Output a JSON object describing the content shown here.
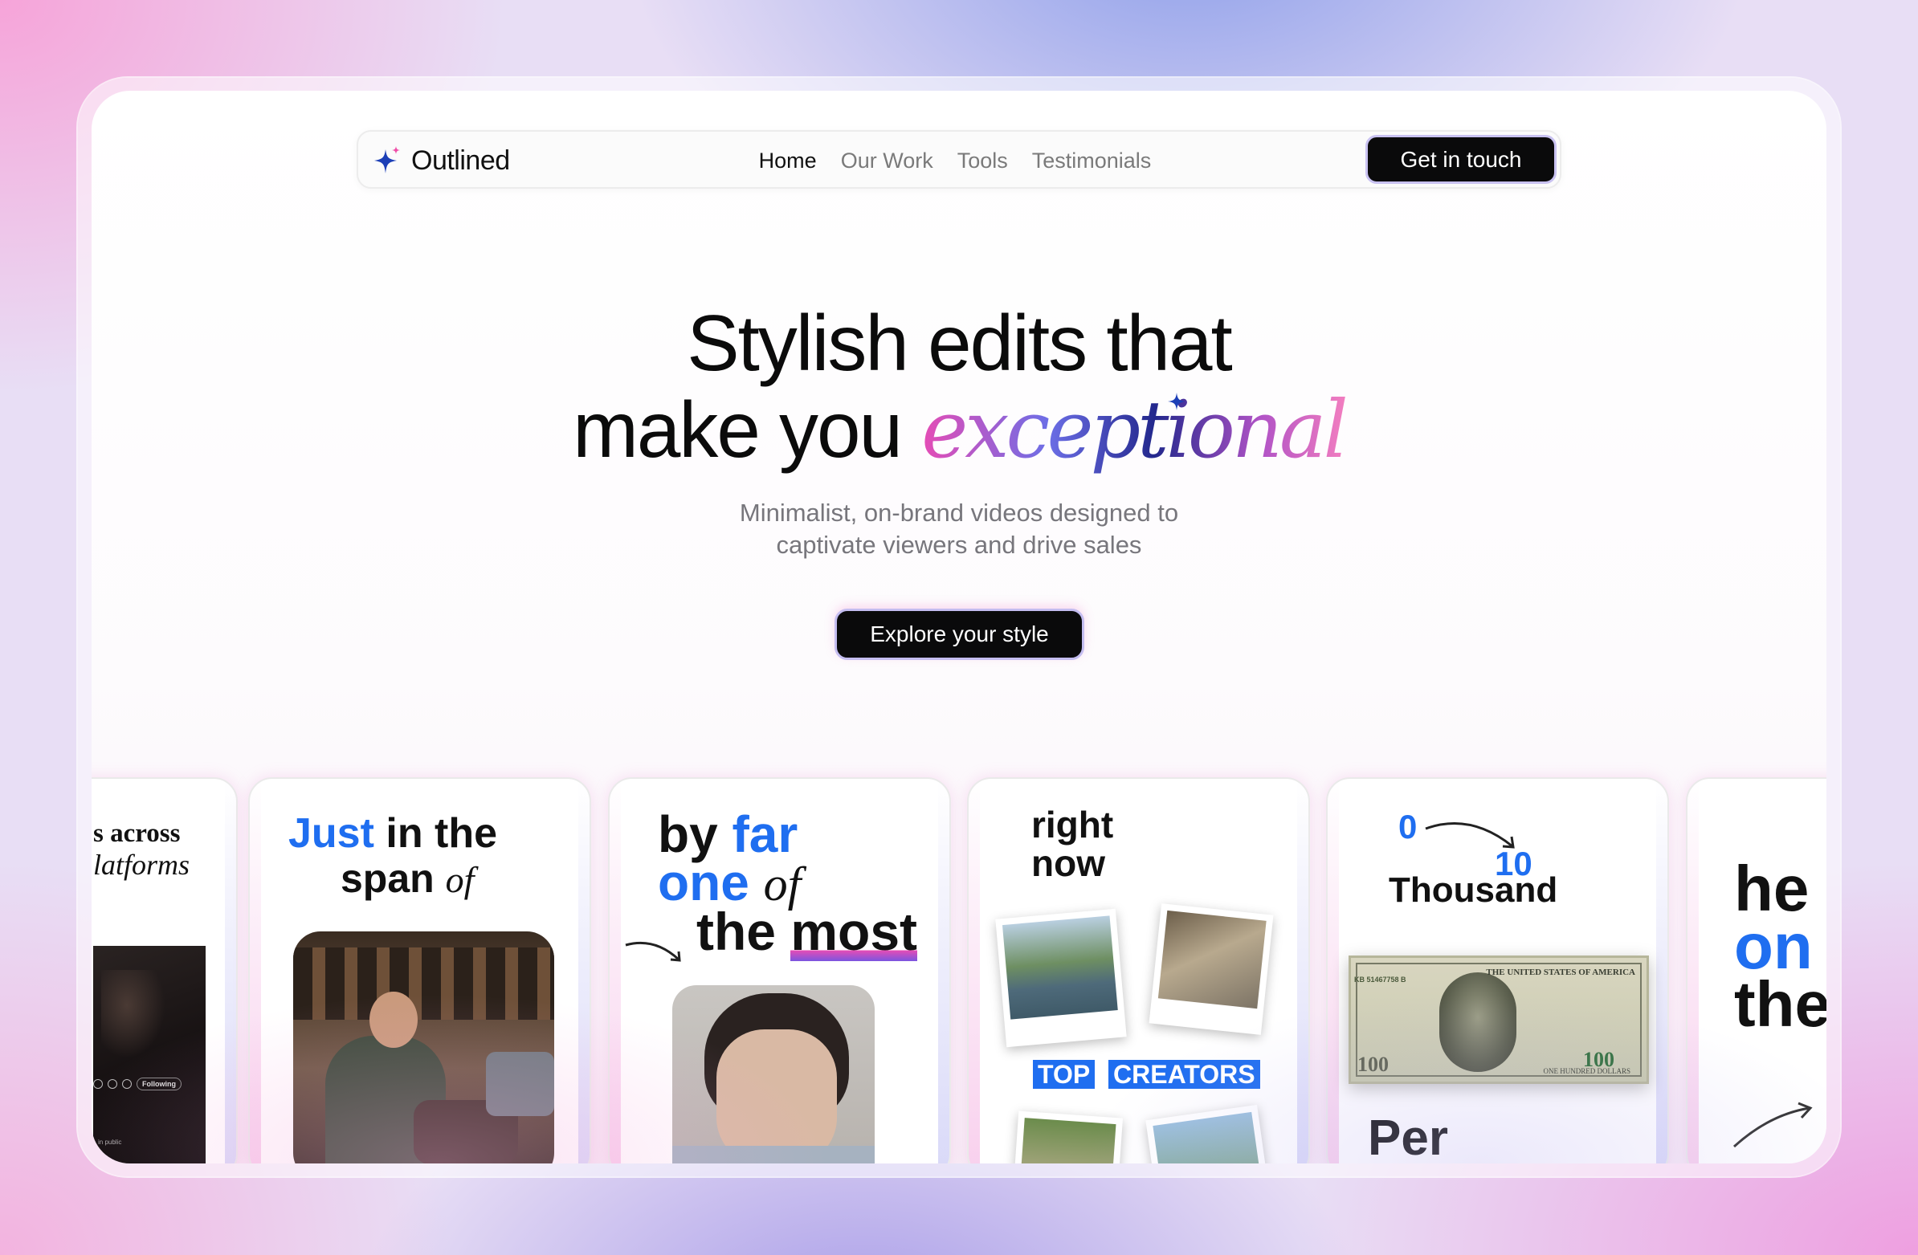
{
  "brand": {
    "name": "Outlined",
    "logo_icon": "sparkle-star-icon"
  },
  "nav": {
    "links": [
      "Home",
      "Our Work",
      "Tools",
      "Testimonials"
    ],
    "active": "Home",
    "cta": "Get in touch"
  },
  "hero": {
    "title_line1": "Stylish edits that",
    "title_line2_plain": "make you ",
    "title_line2_accent": "exceptional",
    "subtitle_line1": "Minimalist, on-brand videos designed to",
    "subtitle_line2": "captivate viewers and drive sales",
    "cta": "Explore your style"
  },
  "cards": {
    "c0": {
      "line1": "s across",
      "line2": "latforms",
      "chip": "Following",
      "footer": "in public"
    },
    "c1": {
      "w1": "Just",
      "w2": " in the",
      "w3": "span ",
      "w4": "of"
    },
    "c2": {
      "w1": "by ",
      "w2": "far",
      "w3": "one ",
      "w4": "of",
      "w5": "the",
      "w6": "most"
    },
    "c3": {
      "line1": "right",
      "line2": "now",
      "tag1": "TOP",
      "tag2": "CREATORS"
    },
    "c4": {
      "from": "0",
      "to": "10",
      "unit": "Thousand",
      "footer": "Per",
      "bill_label": "100",
      "bill_text": "ONE HUNDRED DOLLARS",
      "bill_country": "THE UNITED STATES OF AMERICA",
      "bill_serial": "KB 51467758 B"
    },
    "c5": {
      "line1": "he",
      "line2": "on",
      "line3": "the"
    }
  },
  "colors": {
    "accent_blue": "#1f6ef0",
    "brand_blue": "#1c3fb7",
    "accent_pink": "#e64cb5",
    "cta_bg": "#0a0a0b"
  }
}
